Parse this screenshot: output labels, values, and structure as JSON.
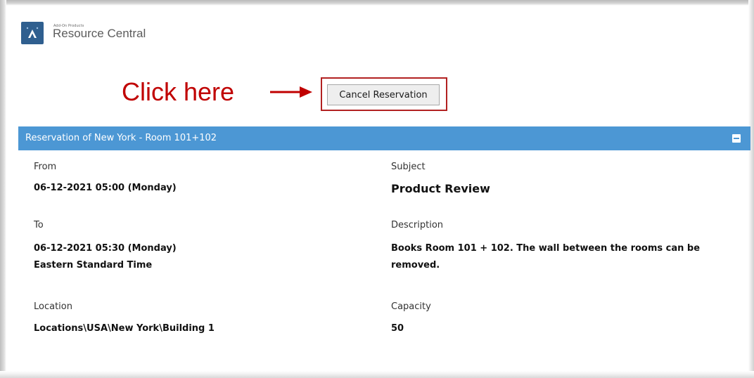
{
  "app": {
    "subtitle": "Add-On Products",
    "title": "Resource Central"
  },
  "callout": {
    "text": "Click here",
    "color": "#c00000"
  },
  "toolbar": {
    "cancel_label": "Cancel Reservation"
  },
  "reservation": {
    "header": "Reservation of New York - Room 101+102",
    "header_color": "#4c97d4",
    "from_label": "From",
    "from_value": "06-12-2021 05:00 (Monday)",
    "to_label": "To",
    "to_value": "06-12-2021 05:30 (Monday)",
    "to_timezone": "Eastern Standard Time",
    "location_label": "Location",
    "location_value": "Locations\\USA\\New York\\Building 1",
    "subject_label": "Subject",
    "subject_value": "Product Review",
    "description_label": "Description",
    "description_line1": "Books Room 101 + 102. The wall between the rooms can be",
    "description_line2": "removed.",
    "capacity_label": "Capacity",
    "capacity_value": "50"
  },
  "icons": {
    "logo": "resource-central-logo-icon",
    "arrow": "arrow-right-icon",
    "collapse": "collapse-minus-icon"
  }
}
